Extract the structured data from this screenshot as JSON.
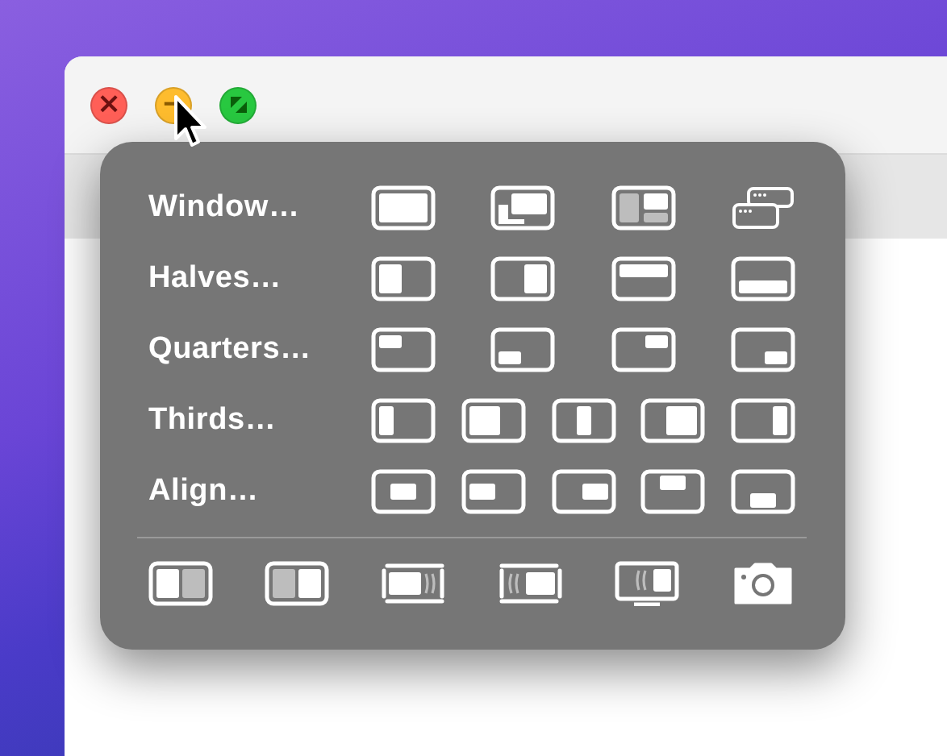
{
  "window": {
    "buttons": [
      {
        "kind": "close",
        "label": "×"
      },
      {
        "kind": "minimize",
        "label": "−"
      },
      {
        "kind": "zoom"
      }
    ]
  },
  "popup": {
    "rows": [
      {
        "label": "Window…"
      },
      {
        "label": "Halves…"
      },
      {
        "label": "Quarters…"
      },
      {
        "label": "Thirds…"
      },
      {
        "label": "Align…"
      }
    ]
  }
}
